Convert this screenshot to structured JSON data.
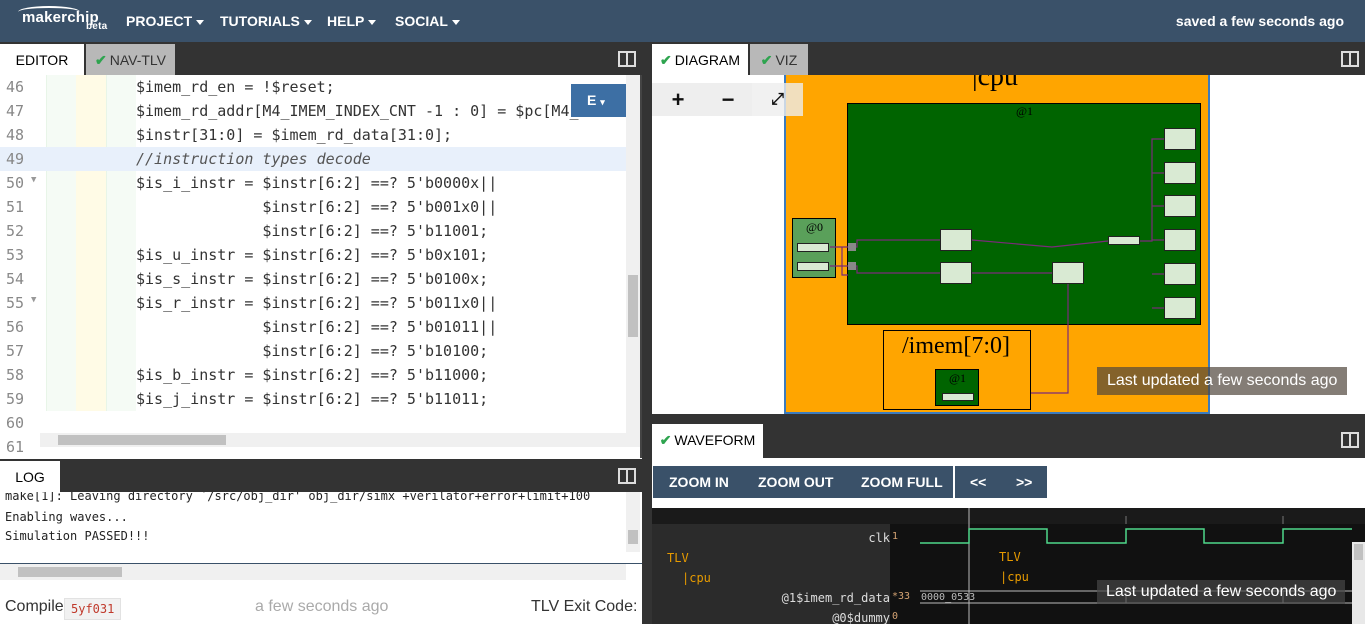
{
  "header": {
    "logo": "makerchip",
    "logo_badge": "beta",
    "menu": [
      "PROJECT",
      "TUTORIALS",
      "HELP",
      "SOCIAL"
    ],
    "status": "saved a few seconds ago"
  },
  "left_tabs": {
    "editor": "EDITOR",
    "nav": "NAV-TLV"
  },
  "editor": {
    "mode_button": "E",
    "lines": [
      {
        "n": "46",
        "text": "$imem_rd_en = !$reset;"
      },
      {
        "n": "47",
        "text": "$imem_rd_addr[M4_IMEM_INDEX_CNT -1 : 0] = $pc[M4_"
      },
      {
        "n": "48",
        "text": "$instr[31:0] = $imem_rd_data[31:0];"
      },
      {
        "n": "49",
        "text": "//instruction types decode"
      },
      {
        "n": "50",
        "text": "$is_i_instr = $instr[6:2] ==? 5'b0000x||"
      },
      {
        "n": "51",
        "text": "              $instr[6:2] ==? 5'b001x0||"
      },
      {
        "n": "52",
        "text": "              $instr[6:2] ==? 5'b11001;"
      },
      {
        "n": "53",
        "text": "$is_u_instr = $instr[6:2] ==? 5'b0x101;"
      },
      {
        "n": "54",
        "text": "$is_s_instr = $instr[6:2] ==? 5'b0100x;"
      },
      {
        "n": "55",
        "text": "$is_r_instr = $instr[6:2] ==? 5'b011x0||"
      },
      {
        "n": "56",
        "text": "              $instr[6:2] ==? 5'b01011||"
      },
      {
        "n": "57",
        "text": "              $instr[6:2] ==? 5'b10100;"
      },
      {
        "n": "58",
        "text": "$is_b_instr = $instr[6:2] ==? 5'b11000;"
      },
      {
        "n": "59",
        "text": "$is_j_instr = $instr[6:2] ==? 5'b11011;"
      },
      {
        "n": "60",
        "text": ""
      },
      {
        "n": "61",
        "text": ""
      }
    ]
  },
  "log": {
    "tab": "LOG",
    "lines": [
      "make[1]: Leaving directory `/src/obj_dir' obj_dir/simx +verilator+error+limit+100",
      "Enabling waves...",
      "Simulation PASSED!!!"
    ]
  },
  "status_bar": {
    "compile_label": "Compile",
    "compile_id": "5yf031",
    "time": "a few seconds ago",
    "exit_code_label": "TLV Exit Code:"
  },
  "right_tabs": {
    "diagram": "DIAGRAM",
    "viz": "VIZ",
    "waveform": "WAVEFORM"
  },
  "diagram": {
    "zoom_in": "+",
    "zoom_out": "−",
    "fit": "⤢",
    "cpu_label": "|cpu",
    "stage1_label": "@1",
    "stage0_label": "@0",
    "imem_label": "/imem[7:0]",
    "imem_stage_label": "@1",
    "last_updated": "Last updated a few seconds ago"
  },
  "waveform": {
    "buttons": [
      "ZOOM IN",
      "ZOOM OUT",
      "ZOOM FULL",
      "<<",
      ">>"
    ],
    "signals": [
      {
        "name": "clk",
        "code": "1"
      },
      {
        "name": "TLV",
        "code": ""
      },
      {
        "name": "|cpu",
        "code": ""
      },
      {
        "name": "@1$imem_rd_data",
        "code": "*33"
      },
      {
        "name": "@0$dummy",
        "code": "0"
      }
    ],
    "value_sample": "0000_0533",
    "tlv_label": "TLV",
    "cpu_label": "|cpu",
    "last_updated": "Last updated a few seconds ago"
  }
}
